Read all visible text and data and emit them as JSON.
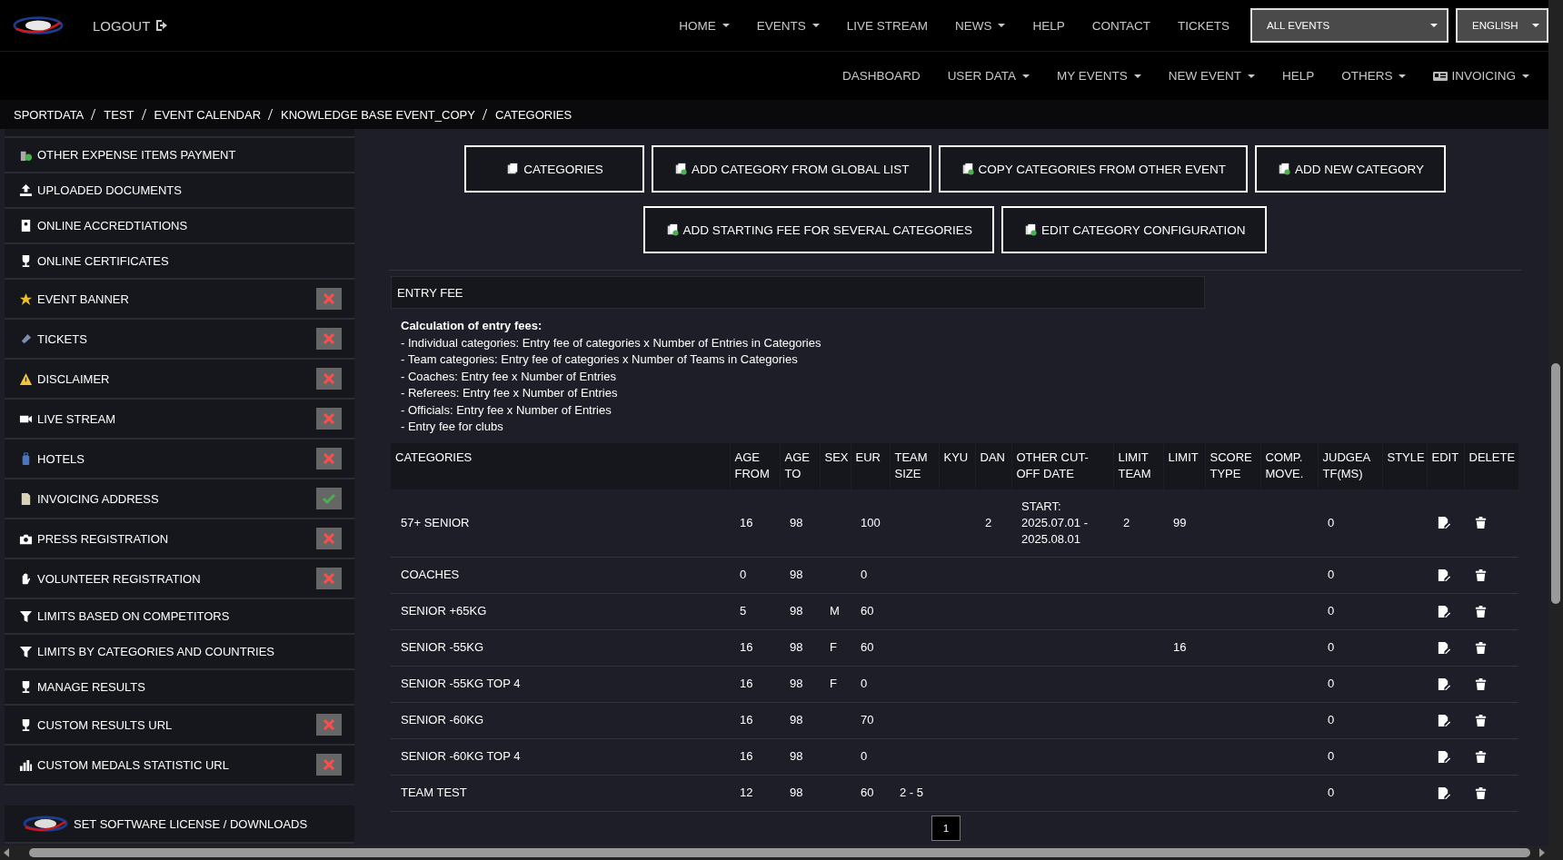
{
  "header": {
    "logout": "LOGOUT",
    "nav": [
      {
        "label": "HOME",
        "dropdown": true
      },
      {
        "label": "EVENTS",
        "dropdown": true
      },
      {
        "label": "LIVE STREAM",
        "dropdown": false
      },
      {
        "label": "NEWS",
        "dropdown": true
      },
      {
        "label": "HELP",
        "dropdown": false
      },
      {
        "label": "CONTACT",
        "dropdown": false
      },
      {
        "label": "TICKETS",
        "dropdown": false
      }
    ],
    "event_select": "ALL EVENTS",
    "language_select": "ENGLISH",
    "subnav": [
      {
        "label": "DASHBOARD",
        "dropdown": false
      },
      {
        "label": "USER DATA",
        "dropdown": true
      },
      {
        "label": "MY EVENTS",
        "dropdown": true
      },
      {
        "label": "NEW EVENT",
        "dropdown": true
      },
      {
        "label": "HELP",
        "dropdown": false
      },
      {
        "label": "OTHERS",
        "dropdown": true
      },
      {
        "label": "INVOICING",
        "dropdown": true
      }
    ]
  },
  "breadcrumb": [
    "SPORTDATA",
    "TEST",
    "EVENT CALENDAR",
    "KNOWLEDGE BASE EVENT_COPY",
    "CATEGORIES"
  ],
  "sidebar": {
    "items": [
      {
        "label": "OTHER EXPENSE ITEMS PAYMENT"
      },
      {
        "label": "UPLOADED DOCUMENTS"
      },
      {
        "label": "ONLINE ACCREDTIATIONS"
      },
      {
        "label": "ONLINE CERTIFICATES"
      },
      {
        "label": "EVENT BANNER",
        "complete": false
      },
      {
        "label": "TICKETS",
        "complete": false
      },
      {
        "label": "DISCLAIMER",
        "complete": false
      },
      {
        "label": "LIVE STREAM",
        "complete": false
      },
      {
        "label": "HOTELS",
        "complete": false
      },
      {
        "label": "INVOICING ADDRESS",
        "complete": true
      },
      {
        "label": "PRESS REGISTRATION",
        "complete": false
      },
      {
        "label": "VOLUNTEER REGISTRATION",
        "complete": false
      },
      {
        "label": "LIMITS BASED ON COMPETITORS"
      },
      {
        "label": "LIMITS BY CATEGORIES AND COUNTRIES"
      },
      {
        "label": "MANAGE RESULTS"
      },
      {
        "label": "CUSTOM RESULTS URL",
        "complete": false
      },
      {
        "label": "CUSTOM MEDALS STATISTIC URL",
        "complete": false
      }
    ],
    "license": "SET SOFTWARE LICENSE / DOWNLOADS"
  },
  "actions": [
    [
      "CATEGORIES",
      "ADD CATEGORY FROM GLOBAL LIST",
      "COPY CATEGORIES FROM OTHER EVENT",
      "ADD NEW CATEGORY"
    ],
    [
      "ADD STARTING FEE FOR SEVERAL CATEGORIES",
      "EDIT CATEGORY CONFIGURATION"
    ]
  ],
  "entry_fee": {
    "title": "ENTRY FEE",
    "heading": "Calculation of entry fees:",
    "lines": [
      "- Individual categories: Entry fee of categories x Number of Entries in Categories",
      "- Team categories: Entry fee of categories x Number of Teams in Categories",
      "- Coaches: Entry fee x Number of Entries",
      "- Referees: Entry fee x Number of Entries",
      "- Officials: Entry fee x Number of Entries",
      "- Entry fee for clubs"
    ]
  },
  "table": {
    "columns": [
      "CATEGORIES",
      "AGE FROM",
      "AGE TO",
      "SEX",
      "EUR",
      "TEAM SIZE",
      "KYU",
      "DAN",
      "OTHER CUT-OFF DATE",
      "LIMIT TEAM",
      "LIMIT",
      "SCORE TYPE",
      "COMP. MOVE.",
      "JUDGEA TF(MS)",
      "STYLE",
      "EDIT",
      "DELETE"
    ],
    "rows": [
      [
        "57+ SENIOR",
        "16",
        "98",
        null,
        "100",
        null,
        null,
        "2",
        "START: 2025.07.01 - 2025.08.01",
        "2",
        "99",
        null,
        null,
        "0",
        null
      ],
      [
        "COACHES",
        "0",
        "98",
        null,
        "0",
        null,
        null,
        null,
        null,
        null,
        null,
        null,
        null,
        "0",
        null
      ],
      [
        "SENIOR +65KG",
        "5",
        "98",
        "M",
        "60",
        null,
        null,
        null,
        null,
        null,
        null,
        null,
        null,
        "0",
        null
      ],
      [
        "SENIOR -55KG",
        "16",
        "98",
        "F",
        "60",
        null,
        null,
        null,
        null,
        null,
        "16",
        null,
        null,
        "0",
        null
      ],
      [
        "SENIOR -55KG TOP 4",
        "16",
        "98",
        "F",
        "0",
        null,
        null,
        null,
        null,
        null,
        null,
        null,
        null,
        "0",
        null
      ],
      [
        "SENIOR -60KG",
        "16",
        "98",
        null,
        "70",
        null,
        null,
        null,
        null,
        null,
        null,
        null,
        null,
        "0",
        null
      ],
      [
        "SENIOR -60KG TOP 4",
        "16",
        "98",
        null,
        "0",
        null,
        null,
        null,
        null,
        null,
        null,
        null,
        null,
        "0",
        null
      ],
      [
        "TEAM TEST",
        "12",
        "98",
        null,
        "60",
        "2 - 5",
        null,
        null,
        null,
        null,
        null,
        null,
        null,
        "0",
        null
      ]
    ]
  },
  "pagination": [
    {
      "label": "1",
      "selected": true
    }
  ]
}
